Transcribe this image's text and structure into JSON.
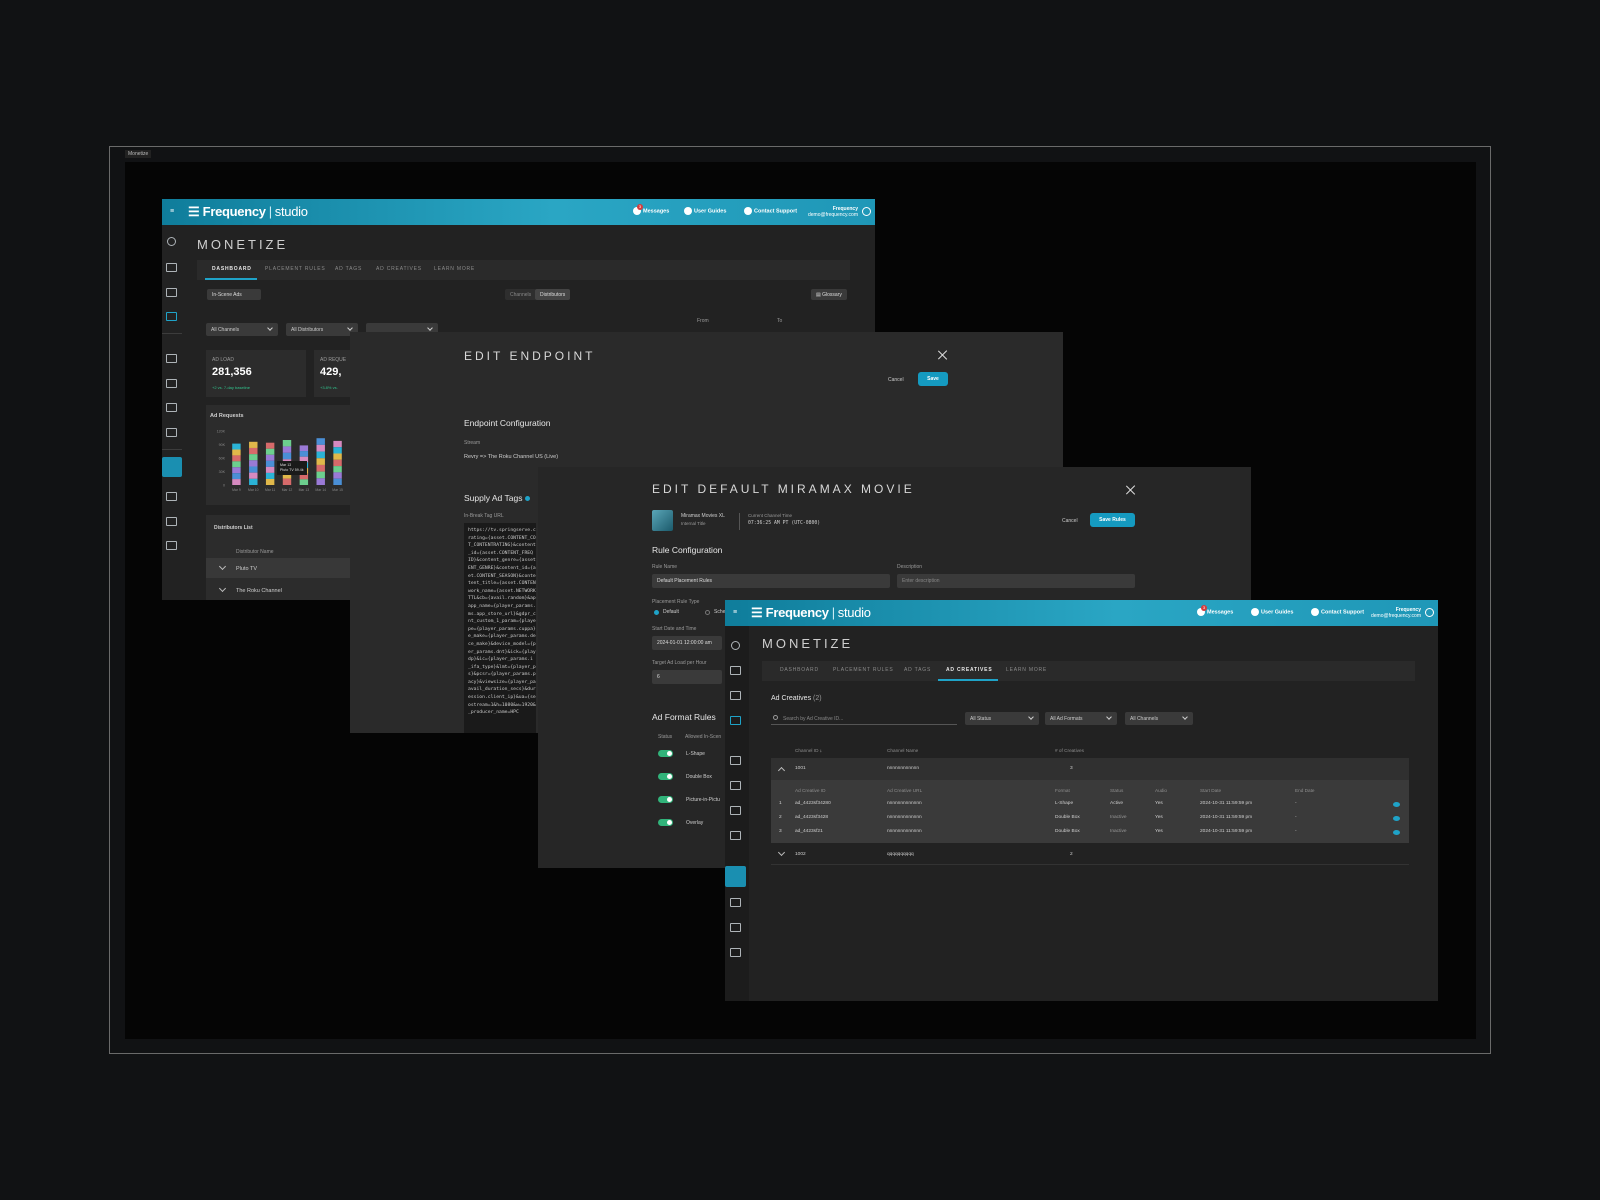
{
  "frame_label": "Monetize",
  "brand": {
    "name": "Frequency",
    "product": "studio"
  },
  "topbar": {
    "messages": "Messages",
    "messages_count": "3",
    "user_guides": "User Guides",
    "contact_support": "Contact Support",
    "user_name": "Frequency",
    "user_email": "demo@frequency.com"
  },
  "colors": {
    "accent": "#1fa3c8",
    "topbar": "#1f97b7",
    "success": "#31c48d",
    "background": "#050505"
  },
  "dashboard": {
    "title": "MONETIZE",
    "tabs": [
      "DASHBOARD",
      "PLACEMENT RULES",
      "AD TAGS",
      "AD CREATIVES",
      "LEARN MORE"
    ],
    "active_tab": "DASHBOARD",
    "filter_pill": "In-Scene Ads",
    "toggle": [
      "Channels",
      "Distributors"
    ],
    "glossary": "Glossary",
    "channels_dd": "All Channels",
    "distributors_dd": "All Distributors",
    "from_label": "From",
    "to_label": "To",
    "ad_load_label": "AD LOAD",
    "ad_load_value": "281,356",
    "ad_load_delta": "+2 vs. 7-day baseline",
    "ad_requests_label": "AD REQUE",
    "ad_requests_value": "429,",
    "ad_requests_delta": "+3.8% vs.",
    "chart_title": "Ad Requests",
    "tooltip_date": "Mar 13",
    "tooltip_text": "Pluto TV  59.4k",
    "distributors_title": "Distributors List",
    "distributor_header": "Distributor Name",
    "distributors": [
      "Pluto TV",
      "The Roku Channel"
    ]
  },
  "chart_data": {
    "type": "bar",
    "title": "Ad Requests",
    "yticks": [
      "120K",
      "90K",
      "60K",
      "30K",
      "0"
    ],
    "categories": [
      "Mar 9",
      "Mar 10",
      "Mar 11",
      "Mar 12",
      "Mar 13",
      "Mar 14",
      "Mar 15"
    ],
    "values": [
      92,
      96,
      94,
      100,
      88,
      104,
      98
    ],
    "ylim": [
      0,
      120
    ]
  },
  "edit_endpoint": {
    "title": "EDIT ENDPOINT",
    "cancel": "Cancel",
    "save": "Save",
    "section": "Endpoint Configuration",
    "stream_label": "Stream",
    "stream_value": "Revry => The Roku Channel US (Live)",
    "supply_title": "Supply Ad Tags",
    "tag_label": "In-Break Tag URL",
    "tag_code": "https://tv.springserve.c\nrating={asset.CONTENT_CO\nT_CONTENTRATING}&content\n_id={asset.CONTENT_FREQ\nID}&content_genre={asset\nENT_GENRE}&content_id={a\net.CONTENT_SEASON}&conte\ntent_title={asset.CONTENT\nwork_name={asset.NETWORK\nTTL&cb={avail.random}&ap\napp_name={player_params.\nms.app_store_url}&gdpr_c\nnt_custom_1_param={playe\npe={player_params.cuppa}\ne_make={player_params.de\nce_make}&device_model={p\ner_params.dnt}&ick={playe\ndp}&ic={player_params.i\n_ifa_type}&lmt={player_p\ns}&pcsr={player_params.p\nacy}&viewsize={player_pa\navail_duration_secs}&dur\nession.client_ip}&ua={se\nostream=1&h=1080&w=1920&\n_producer_name=HPC"
  },
  "edit_rule": {
    "title": "EDIT DEFAULT MIRAMAX MOVIE",
    "channel_name": "Miramax Movies XL",
    "channel_sub": "Internal Title",
    "time_label": "Current Channel Time",
    "time_value": "07:36:25 AM PT (UTC-0800)",
    "cancel": "Cancel",
    "save": "Save Rules",
    "section": "Rule Configuration",
    "rule_name_label": "Rule Name",
    "rule_name_value": "Default Placement Rules",
    "description_label": "Description",
    "description_placeholder": "Enter description",
    "type_label": "Placement Rule Type",
    "type_default": "Default",
    "type_sched": "Sche",
    "start_label": "Start Date and Time",
    "start_value": "2024-01-01 12:00:00 am",
    "target_label": "Target Ad Load per Hour",
    "target_value": "6",
    "formats_title": "Ad Format Rules",
    "status_header": "Status",
    "allowed_header": "Allowed In-Scen",
    "formats": [
      "L-Shape",
      "Double Box",
      "Picture-in-Pictu",
      "Overlay"
    ]
  },
  "creatives": {
    "title": "MONETIZE",
    "tabs": [
      "DASHBOARD",
      "PLACEMENT RULES",
      "AD TAGS",
      "AD CREATIVES",
      "LEARN MORE"
    ],
    "active_tab": "AD CREATIVES",
    "heading": "Ad Creatives",
    "count": "(2)",
    "search_placeholder": "Search by Ad Creative ID...",
    "filters": [
      "All Status",
      "All Ad Formats",
      "All Channels"
    ],
    "headers": [
      "Channel ID",
      "Channel Name",
      "# of Creatives"
    ],
    "sub_headers": [
      "Ad Creative ID",
      "Ad Creative URL",
      "Format",
      "Status",
      "Audio",
      "Start Date",
      "End Date"
    ],
    "groups": [
      {
        "id": "1001",
        "name": "nnnnnnnnnnnn",
        "count": "3"
      },
      {
        "id": "1002",
        "name": "qqqqqqqqqq",
        "count": "2"
      }
    ],
    "rows": [
      {
        "n": "1",
        "id": "ad_4423sf34280",
        "url": "nnnnnnnnnnnnn",
        "format": "L-Shape",
        "status": "Active",
        "audio": "Yes",
        "start": "2024-10-31 11:59:59 pm",
        "end": "-"
      },
      {
        "n": "2",
        "id": "ad_4423sf3428",
        "url": "nnnnnnnnnnnnn",
        "format": "Double Box",
        "status": "Inactive",
        "audio": "Yes",
        "start": "2024-10-31 11:59:59 pm",
        "end": "-"
      },
      {
        "n": "3",
        "id": "ad_4423sf21",
        "url": "nnnnnnnnnnnnn",
        "format": "Double Box",
        "status": "Inactive",
        "audio": "Yes",
        "start": "2024-10-31 11:59:59 pm",
        "end": "-"
      }
    ]
  }
}
